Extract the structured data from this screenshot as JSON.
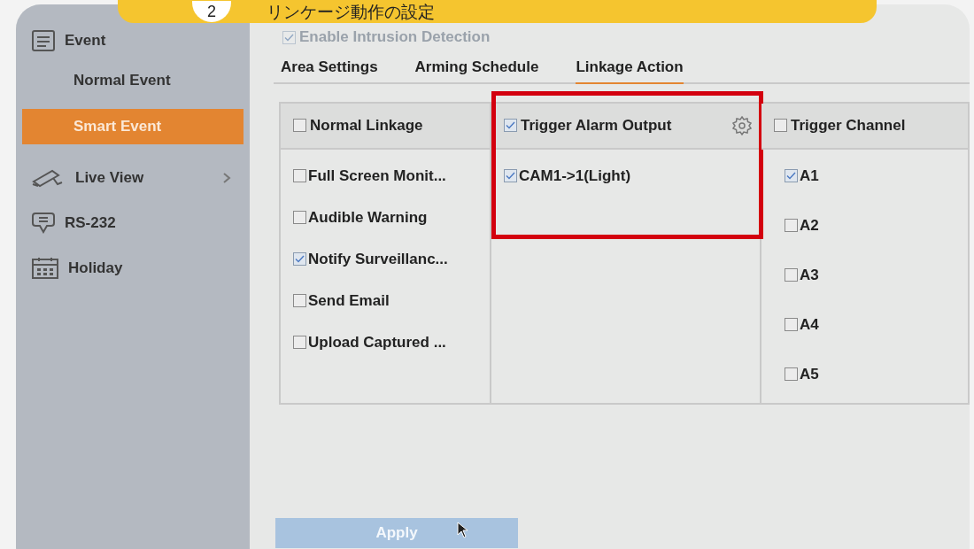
{
  "banner": {
    "step": "2",
    "title": "リンケージ動作の設定"
  },
  "sidebar": {
    "items": [
      {
        "label": "Event",
        "selected": false,
        "children": [
          {
            "label": "Normal Event",
            "selected": false
          },
          {
            "label": "Smart Event",
            "selected": true
          }
        ]
      },
      {
        "label": "Live View",
        "selected": false,
        "has_submenu": true
      },
      {
        "label": "RS-232",
        "selected": false,
        "has_submenu": false
      },
      {
        "label": "Holiday",
        "selected": false,
        "has_submenu": false
      }
    ]
  },
  "enable_option": {
    "label": "Enable Intrusion Detection",
    "checked": true,
    "disabled": true
  },
  "tabs": [
    {
      "label": "Area Settings",
      "selected": false
    },
    {
      "label": "Arming Schedule",
      "selected": false
    },
    {
      "label": "Linkage Action",
      "selected": true
    }
  ],
  "linkage_columns": [
    {
      "header": "Normal Linkage",
      "checked": false,
      "has_settings": false,
      "highlighted": false,
      "items": [
        {
          "label": "Full Screen Monit...",
          "checked": false
        },
        {
          "label": "Audible Warning",
          "checked": false
        },
        {
          "label": "Notify Surveillanc...",
          "checked": true
        },
        {
          "label": "Send Email",
          "checked": false
        },
        {
          "label": "Upload Captured ...",
          "checked": false
        }
      ]
    },
    {
      "header": "Trigger Alarm Output",
      "checked": true,
      "has_settings": true,
      "highlighted": true,
      "items": [
        {
          "label": "CAM1->1(Light)",
          "checked": true
        }
      ]
    },
    {
      "header": "Trigger Channel",
      "checked": false,
      "has_settings": false,
      "highlighted": false,
      "items": [
        {
          "label": "A1",
          "checked": true
        },
        {
          "label": "A2",
          "checked": false
        },
        {
          "label": "A3",
          "checked": false
        },
        {
          "label": "A4",
          "checked": false
        },
        {
          "label": "A5",
          "checked": false
        }
      ]
    }
  ],
  "apply_button": {
    "label": "Apply",
    "disabled": true
  }
}
